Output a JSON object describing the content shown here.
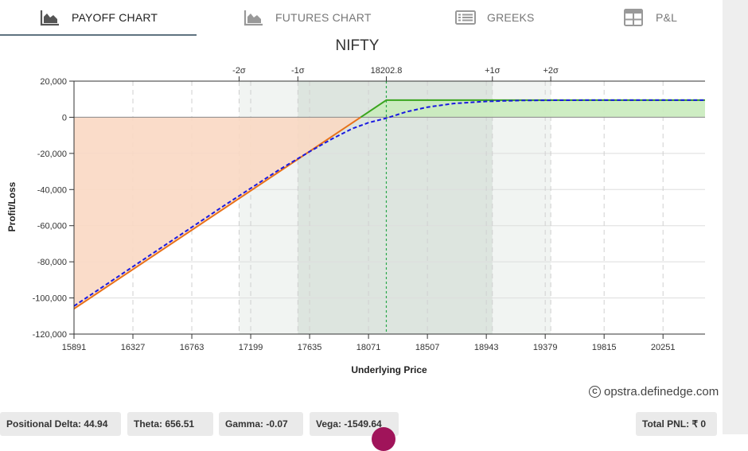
{
  "tabs": [
    {
      "label": "PAYOFF CHART",
      "icon": "area-chart-icon",
      "active": true
    },
    {
      "label": "FUTURES CHART",
      "icon": "area-chart-icon",
      "active": false
    },
    {
      "label": "GREEKS",
      "icon": "list-table-icon",
      "active": false
    },
    {
      "label": "P&L",
      "icon": "grid-table-icon",
      "active": false
    }
  ],
  "chart_data": {
    "type": "line",
    "title": "NIFTY",
    "xlabel": "Underlying Price",
    "ylabel": "Profit/Loss",
    "xlim": [
      15891,
      20562
    ],
    "ylim": [
      -120000,
      20000
    ],
    "x_ticks": [
      15891,
      16327,
      16763,
      17199,
      17635,
      18071,
      18507,
      18943,
      19379,
      19815,
      20251
    ],
    "x_tick_labels": [
      "15891",
      "16327",
      "16763",
      "17199",
      "17635",
      "18071",
      "18507",
      "18943",
      "19379",
      "19815",
      "20251"
    ],
    "y_ticks": [
      20000,
      0,
      -20000,
      -40000,
      -60000,
      -80000,
      -100000,
      -120000
    ],
    "y_tick_labels": [
      "20,000",
      "0",
      "-20,000",
      "-40,000",
      "-60,000",
      "-80,000",
      "-100,000",
      "-120,000"
    ],
    "grid": true,
    "sigma_markers": [
      {
        "label": "-2σ",
        "x": 17113
      },
      {
        "label": "-1σ",
        "x": 17548
      },
      {
        "label": "18202.8",
        "x": 18203
      },
      {
        "label": "+1σ",
        "x": 18988
      },
      {
        "label": "+2σ",
        "x": 19420
      }
    ],
    "sigma_bands": [
      {
        "from": 17113,
        "to": 19420,
        "level": 2
      },
      {
        "from": 17548,
        "to": 18988,
        "level": 1
      }
    ],
    "spot": 18202.8,
    "series": [
      {
        "role": "expiry",
        "color": "#e8711a",
        "x": [
          15891,
          18203,
          20562
        ],
        "y": [
          -106000,
          9500,
          9500
        ]
      },
      {
        "role": "target",
        "color": "#1a1ae0",
        "x": [
          15891,
          17000,
          17400,
          17635,
          17800,
          17950,
          18071,
          18203,
          18350,
          18507,
          18700,
          18943,
          19200,
          19400,
          19800,
          20562
        ],
        "y": [
          -104500,
          -49000,
          -29500,
          -19000,
          -12000,
          -6300,
          -3000,
          -500,
          3000,
          5600,
          7600,
          8800,
          9300,
          9400,
          9500,
          9500
        ]
      }
    ],
    "colors": {
      "profit_fill": "#c9ebbd",
      "loss_fill": "#f9d8c3",
      "band1": "#d8e1da",
      "band2": "#eef1ef",
      "profit_line": "#3aa51e",
      "loss_line": "#e8711a",
      "target_line": "#1a1ae0",
      "spot_line": "#2aa84a"
    }
  },
  "watermark": "opstra.definedge.com",
  "stats": [
    {
      "label": "Positional Delta: 44.94"
    },
    {
      "label": "Theta: 656.51"
    },
    {
      "label": "Gamma: -0.07"
    },
    {
      "label": "Vega: -1549.64"
    },
    {
      "label": "Total PNL: ₹ 0"
    }
  ]
}
